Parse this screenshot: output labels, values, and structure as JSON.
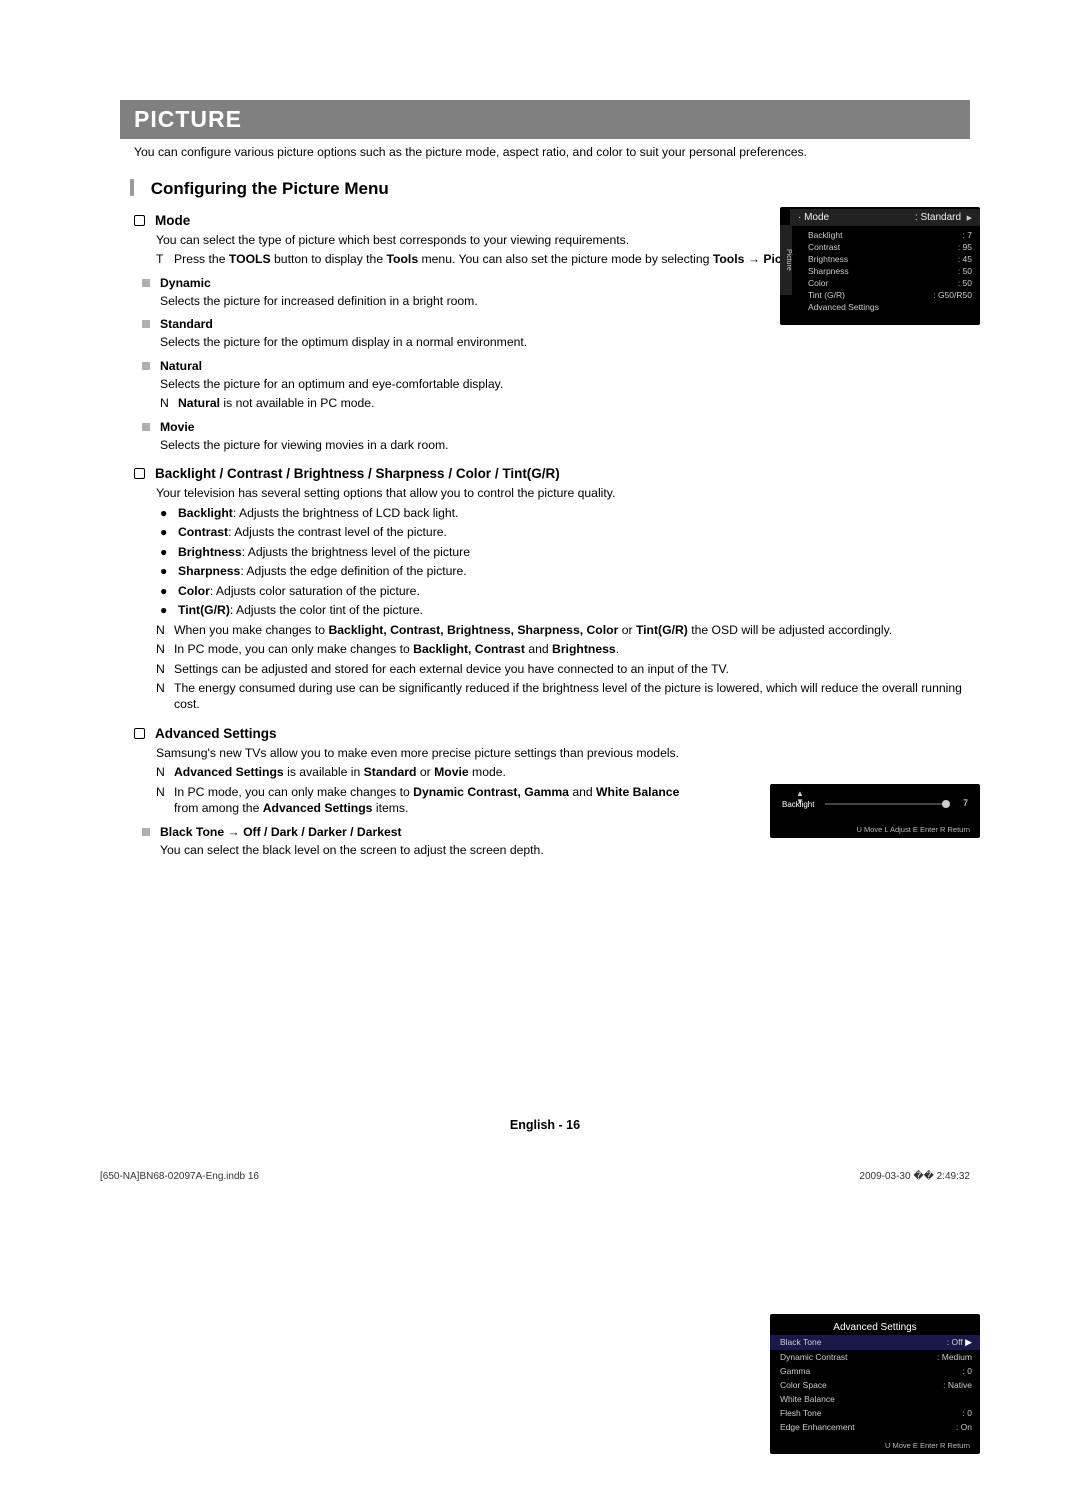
{
  "title_bar": "PICTURE",
  "intro": "You can configure various picture options such as the picture mode, aspect ratio, and color to suit your personal preferences.",
  "section_heading": "Configuring the Picture Menu",
  "mode": {
    "heading": "Mode",
    "desc": "You can select the type of picture which best corresponds to your viewing requirements.",
    "tool_note_prefix": "T",
    "tool_note_1": "Press the ",
    "tool_note_b1": "TOOLS",
    "tool_note_2": " button to display the ",
    "tool_note_b2": "Tools",
    "tool_note_3": " menu. You can also set the picture mode by selecting ",
    "tool_note_b3": "Tools → Picture Mode",
    "tool_note_4": ".",
    "dynamic": {
      "h": "Dynamic",
      "d": "Selects the picture for increased definition in a bright room."
    },
    "standard": {
      "h": "Standard",
      "d": "Selects the picture for the optimum display in a normal environment."
    },
    "natural": {
      "h": "Natural",
      "d": "Selects the picture for an optimum and eye-comfortable display.",
      "note_prefix": "N",
      "note_b": "Natural",
      "note_rest": " is not available in PC mode."
    },
    "movie": {
      "h": "Movie",
      "d": "Selects the picture for viewing movies in a dark room."
    }
  },
  "adjust": {
    "heading": "Backlight / Contrast / Brightness / Sharpness / Color / Tint(G/R)",
    "desc": "Your television has several setting options that allow you to control the picture quality.",
    "items": [
      {
        "b": "Backlight",
        "rest": ": Adjusts the brightness of LCD back light."
      },
      {
        "b": "Contrast",
        "rest": ": Adjusts the contrast level of the picture."
      },
      {
        "b": "Brightness",
        "rest": ": Adjusts the brightness level of the picture"
      },
      {
        "b": "Sharpness",
        "rest": ": Adjusts the edge definition of the picture."
      },
      {
        "b": "Color",
        "rest": ": Adjusts color saturation of the picture."
      },
      {
        "b": "Tint(G/R)",
        "rest": ": Adjusts the color tint of the picture."
      }
    ],
    "notes": [
      {
        "p": "N",
        "pre": "When you make changes to ",
        "b": "Backlight, Contrast, Brightness, Sharpness, Color",
        "mid": " or ",
        "b2": "Tint(G/R)",
        "rest": " the OSD will be adjusted accordingly."
      },
      {
        "p": "N",
        "pre": "In PC mode, you can only make changes to ",
        "b": "Backlight, Contrast",
        "mid": " and ",
        "b2": "Brightness",
        "rest": "."
      },
      {
        "p": "N",
        "pre": "Settings can be adjusted and stored for each external device you have connected to an input of the TV.",
        "b": "",
        "mid": "",
        "b2": "",
        "rest": ""
      },
      {
        "p": "N",
        "pre": "The energy consumed during use can be significantly reduced if the brightness level of the picture is lowered, which will reduce the overall running cost.",
        "b": "",
        "mid": "",
        "b2": "",
        "rest": ""
      }
    ]
  },
  "advanced": {
    "heading": "Advanced Settings",
    "desc": "Samsung's new TVs allow you to make even more precise picture settings than previous models.",
    "note1": {
      "p": "N",
      "b": "Advanced Settings",
      "rest": " is available in ",
      "b2": "Standard",
      "mid": " or ",
      "b3": "Movie",
      "rest2": " mode."
    },
    "note2": {
      "p": "N",
      "pre": "In PC mode, you can only make changes to ",
      "b": "Dynamic Contrast, Gamma",
      "mid": " and ",
      "b2": "White Balance",
      "rest": " from among the ",
      "b3": "Advanced Settings",
      "rest2": " items."
    },
    "sub": {
      "h": "Black Tone → Off / Dark / Darker / Darkest",
      "d": "You can select the black level on the screen to adjust the screen depth."
    }
  },
  "osd1": {
    "side": "Picture",
    "title_l": "· Mode",
    "title_r": ": Standard",
    "arrow": "▶",
    "rows": [
      {
        "l": "Backlight",
        "r": ": 7"
      },
      {
        "l": "Contrast",
        "r": ": 95"
      },
      {
        "l": "Brightness",
        "r": ": 45"
      },
      {
        "l": "Sharpness",
        "r": ": 50"
      },
      {
        "l": "Color",
        "r": ": 50"
      },
      {
        "l": "Tint (G/R)",
        "r": ": G50/R50"
      },
      {
        "l": "Advanced Settings",
        "r": ""
      }
    ]
  },
  "osd2": {
    "up": "▲",
    "down": "▼",
    "label": "Backlight",
    "value": "7",
    "footer": "U Move   L Adjust   E Enter   R Return"
  },
  "osd3": {
    "title": "Advanced Settings",
    "rows": [
      {
        "l": "Black Tone",
        "r": ": Off",
        "sel": true
      },
      {
        "l": "Dynamic Contrast",
        "r": ": Medium"
      },
      {
        "l": "Gamma",
        "r": ": 0"
      },
      {
        "l": "Color Space",
        "r": ": Native"
      },
      {
        "l": "White Balance",
        "r": ""
      },
      {
        "l": "Flesh Tone",
        "r": ": 0"
      },
      {
        "l": "Edge Enhancement",
        "r": ": On"
      }
    ],
    "footer": "U Move   E Enter   R Return"
  },
  "footer_page": "English - 16",
  "print_foot_left": "[650-NA]BN68-02097A-Eng.indb   16",
  "print_foot_right": "2009-03-30   �� 2:49:32"
}
